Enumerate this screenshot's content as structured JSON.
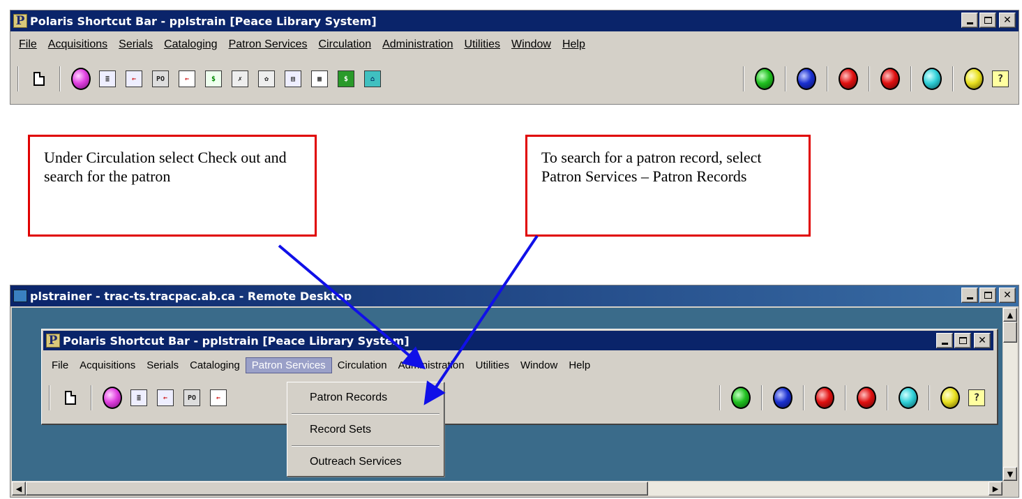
{
  "top_window": {
    "title": "Polaris Shortcut Bar - pplstrain [Peace Library System]",
    "menu": [
      "File",
      "Acquisitions",
      "Serials",
      "Cataloging",
      "Patron Services",
      "Circulation",
      "Administration",
      "Utilities",
      "Window",
      "Help"
    ]
  },
  "callouts": {
    "left": "Under Circulation select Check out and search for the patron",
    "right": "To search for a patron record, select Patron Services – Patron Records"
  },
  "remote_desktop": {
    "title": "plstrainer - trac-ts.tracpac.ab.ca - Remote Desktop"
  },
  "inner_window": {
    "title": "Polaris Shortcut Bar - pplstrain [Peace Library System]",
    "menu": [
      "File",
      "Acquisitions",
      "Serials",
      "Cataloging",
      "Patron Services",
      "Circulation",
      "Administration",
      "Utilities",
      "Window",
      "Help"
    ],
    "open_menu": "Patron Services",
    "popup_items": [
      "Patron Records",
      "Record Sets",
      "Outreach Services"
    ]
  },
  "colors": {
    "titlebar": "#0a246a",
    "desktop": "#3a6b8a",
    "callout_border": "#e00000",
    "arrow": "#1010e8",
    "ball_magenta": "#e040e0",
    "ball_green": "#20c020",
    "ball_blue": "#1a30d0",
    "ball_red": "#e01010",
    "ball_cyan": "#30d0d8",
    "ball_yellow": "#e8e020"
  }
}
